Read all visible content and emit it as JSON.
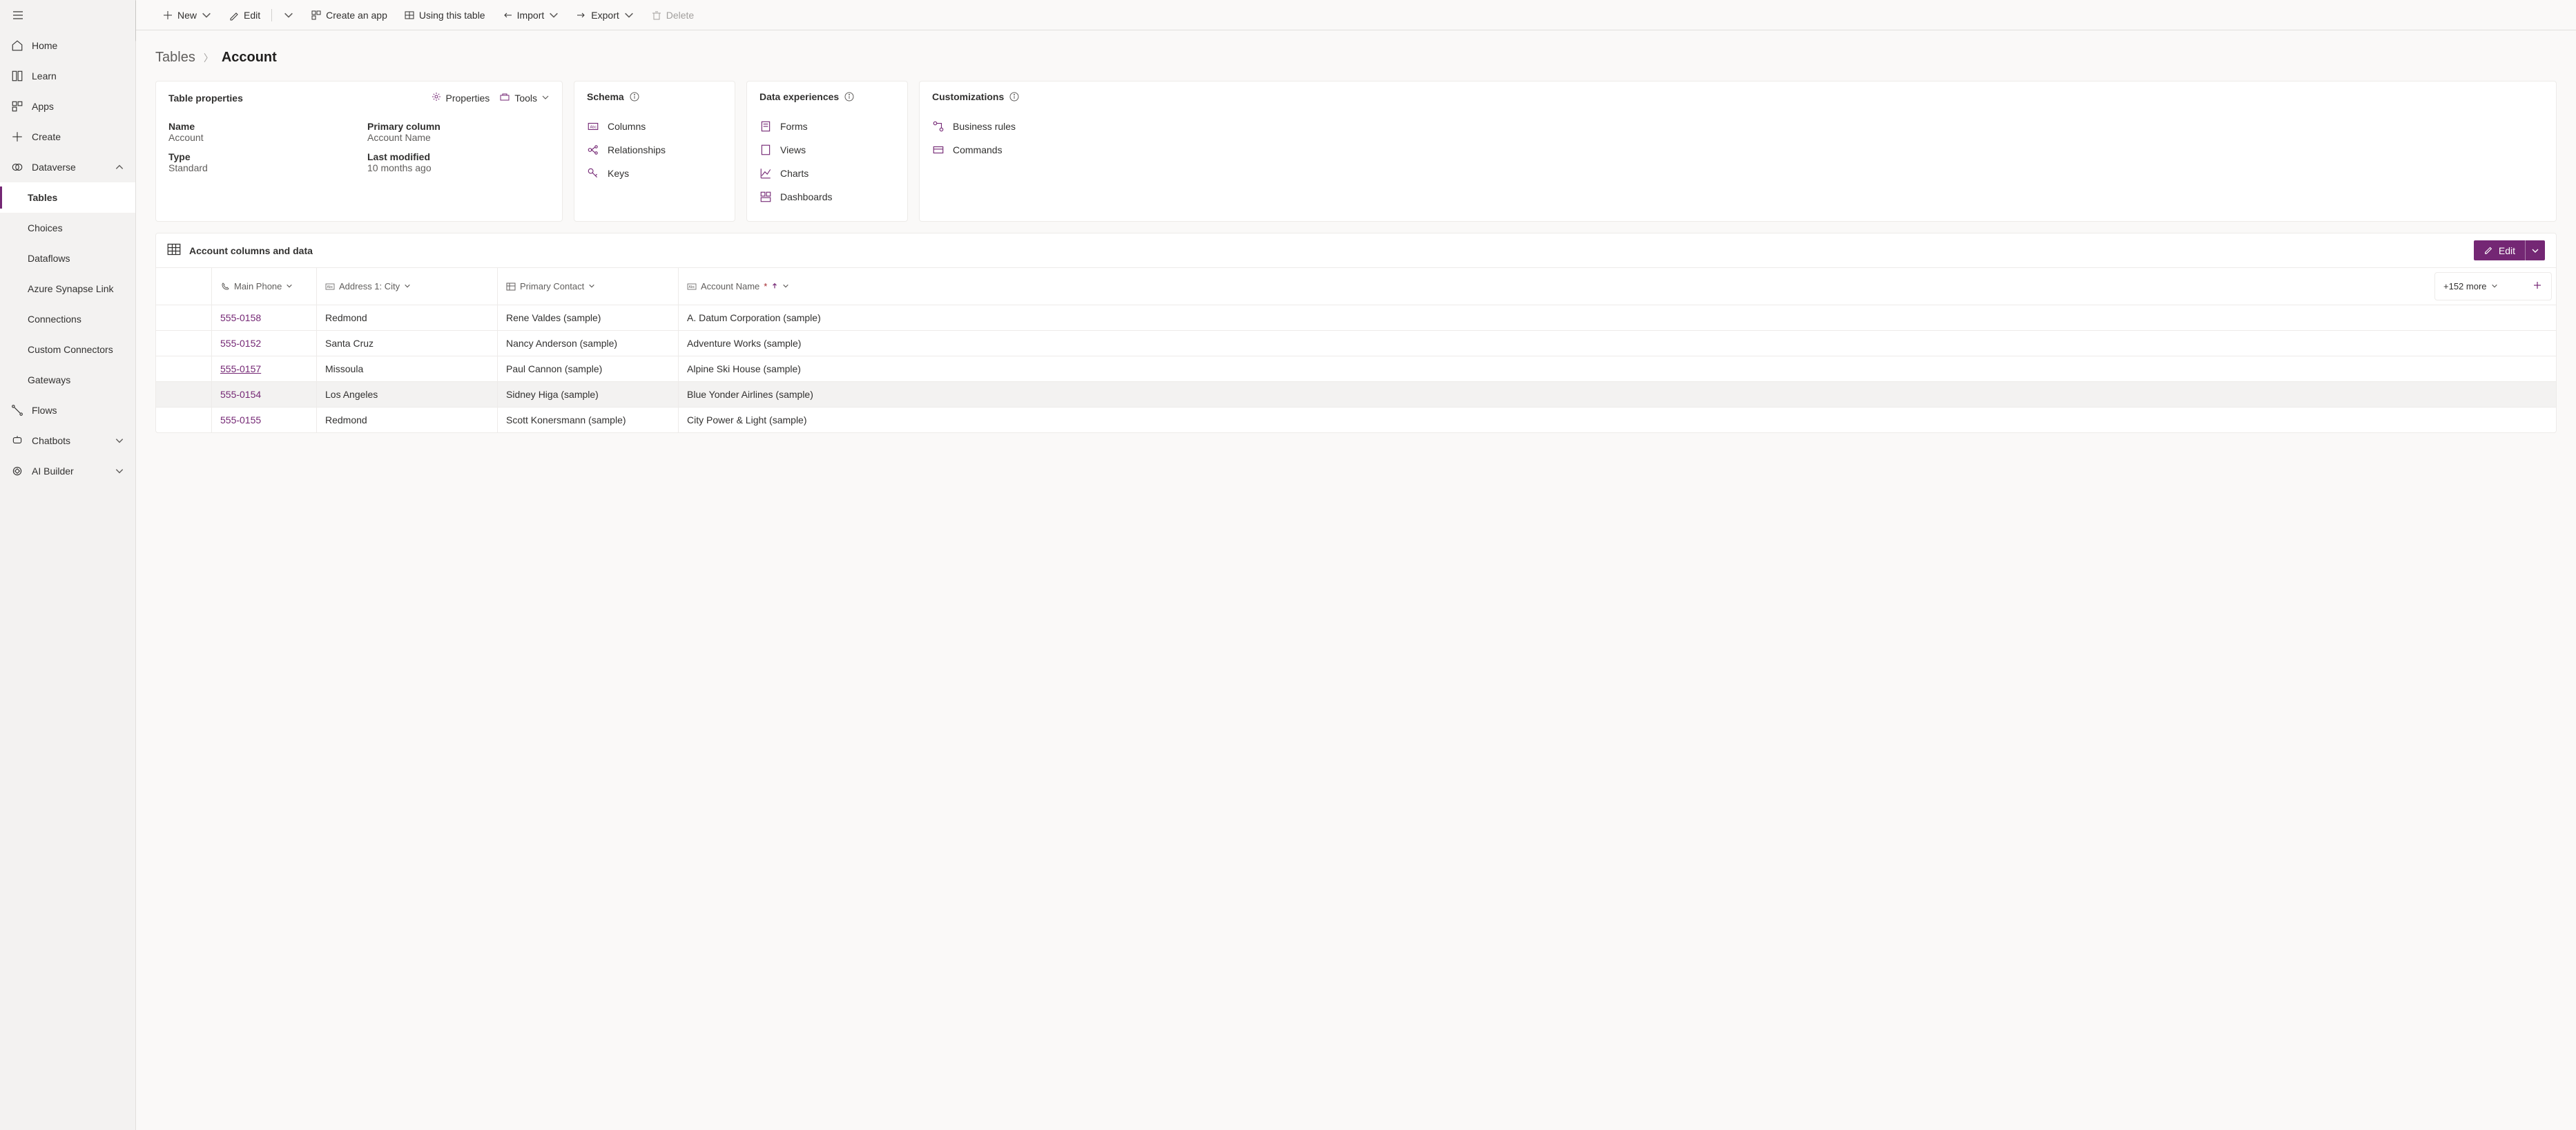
{
  "sidebar": {
    "items": [
      {
        "key": "home",
        "label": "Home"
      },
      {
        "key": "learn",
        "label": "Learn"
      },
      {
        "key": "apps",
        "label": "Apps"
      },
      {
        "key": "create",
        "label": "Create"
      },
      {
        "key": "dataverse",
        "label": "Dataverse"
      },
      {
        "key": "tables",
        "label": "Tables"
      },
      {
        "key": "choices",
        "label": "Choices"
      },
      {
        "key": "dataflows",
        "label": "Dataflows"
      },
      {
        "key": "synapse",
        "label": "Azure Synapse Link"
      },
      {
        "key": "connections",
        "label": "Connections"
      },
      {
        "key": "customconn",
        "label": "Custom Connectors"
      },
      {
        "key": "gateways",
        "label": "Gateways"
      },
      {
        "key": "flows",
        "label": "Flows"
      },
      {
        "key": "chatbots",
        "label": "Chatbots"
      },
      {
        "key": "aibuilder",
        "label": "AI Builder"
      }
    ]
  },
  "toolbar": {
    "new": "New",
    "edit": "Edit",
    "createapp": "Create an app",
    "usingtable": "Using this table",
    "import": "Import",
    "export": "Export",
    "delete": "Delete"
  },
  "breadcrumb": {
    "parent": "Tables",
    "current": "Account"
  },
  "cards": {
    "props": {
      "title": "Table properties",
      "actions": {
        "properties": "Properties",
        "tools": "Tools"
      },
      "name_label": "Name",
      "name_value": "Account",
      "primarycol_label": "Primary column",
      "primarycol_value": "Account Name",
      "type_label": "Type",
      "type_value": "Standard",
      "lastmod_label": "Last modified",
      "lastmod_value": "10 months ago"
    },
    "schema": {
      "title": "Schema",
      "items": [
        "Columns",
        "Relationships",
        "Keys"
      ]
    },
    "dataexp": {
      "title": "Data experiences",
      "items": [
        "Forms",
        "Views",
        "Charts",
        "Dashboards"
      ]
    },
    "custom": {
      "title": "Customizations",
      "items": [
        "Business rules",
        "Commands"
      ]
    }
  },
  "data_section": {
    "title": "Account columns and data",
    "edit_label": "Edit",
    "more_label": "+152 more",
    "columns": {
      "phone": "Main Phone",
      "city": "Address 1: City",
      "contact": "Primary Contact",
      "name": "Account Name"
    },
    "rows": [
      {
        "phone": "555-0158",
        "city": "Redmond",
        "contact": "Rene Valdes (sample)",
        "name": "A. Datum Corporation (sample)"
      },
      {
        "phone": "555-0152",
        "city": "Santa Cruz",
        "contact": "Nancy Anderson (sample)",
        "name": "Adventure Works (sample)"
      },
      {
        "phone": "555-0157",
        "city": "Missoula",
        "contact": "Paul Cannon (sample)",
        "name": "Alpine Ski House (sample)"
      },
      {
        "phone": "555-0154",
        "city": "Los Angeles",
        "contact": "Sidney Higa (sample)",
        "name": "Blue Yonder Airlines (sample)"
      },
      {
        "phone": "555-0155",
        "city": "Redmond",
        "contact": "Scott Konersmann (sample)",
        "name": "City Power & Light (sample)"
      }
    ]
  }
}
